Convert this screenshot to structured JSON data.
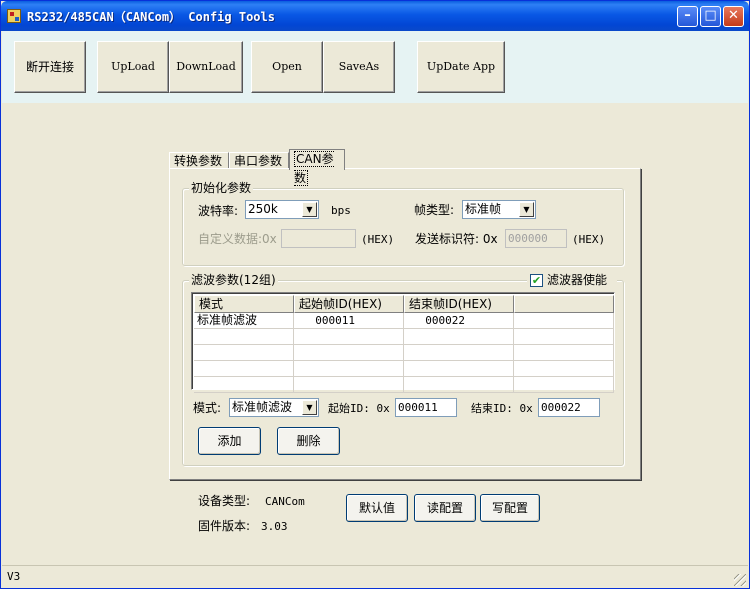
{
  "window": {
    "title": "RS232/485CAN（CANCom） Config Tools",
    "minimize": "–",
    "maximize": "□",
    "close": "✕"
  },
  "toolbar": {
    "disconnect": "断开连接",
    "upload": "UpLoad",
    "download": "DownLoad",
    "open": "Open",
    "saveas": "SaveAs",
    "update_app": "UpDate App"
  },
  "tabs": [
    "转换参数",
    "串口参数",
    "CAN参数"
  ],
  "init": {
    "group_title": "初始化参数",
    "baud_label": "波特率:",
    "baud_value": "250k",
    "baud_unit": "bps",
    "frame_type_label": "帧类型:",
    "frame_type_value": "标准帧",
    "custom_label": "自定义数据:0x",
    "custom_value": "",
    "hex1": "(HEX)",
    "send_id_label": "发送标识符: 0x",
    "send_id_value": "000000",
    "hex2": "(HEX)"
  },
  "filter": {
    "group_title": "滤波参数(12组)",
    "enable_label": "滤波器使能",
    "enable_checked": true,
    "columns": [
      "模式",
      "起始帧ID(HEX)",
      "结束帧ID(HEX)",
      ""
    ],
    "rows": [
      [
        "标准帧滤波",
        "000011",
        "000022",
        ""
      ],
      [
        "",
        "",
        "",
        ""
      ],
      [
        "",
        "",
        "",
        ""
      ],
      [
        "",
        "",
        "",
        ""
      ],
      [
        "",
        "",
        "",
        ""
      ]
    ],
    "mode_label": "模式:",
    "mode_value": "标准帧滤波",
    "start_label": "起始ID: 0x",
    "start_value": "000011",
    "end_label": "结束ID: 0x",
    "end_value": "000022",
    "add": "添加",
    "delete": "删除"
  },
  "device": {
    "type_label": "设备类型:",
    "type_value": "CANCom",
    "fw_label": "固件版本:",
    "fw_value": "3.03",
    "default": "默认值",
    "read": "读配置",
    "write": "写配置"
  },
  "status": {
    "version": "V3"
  }
}
